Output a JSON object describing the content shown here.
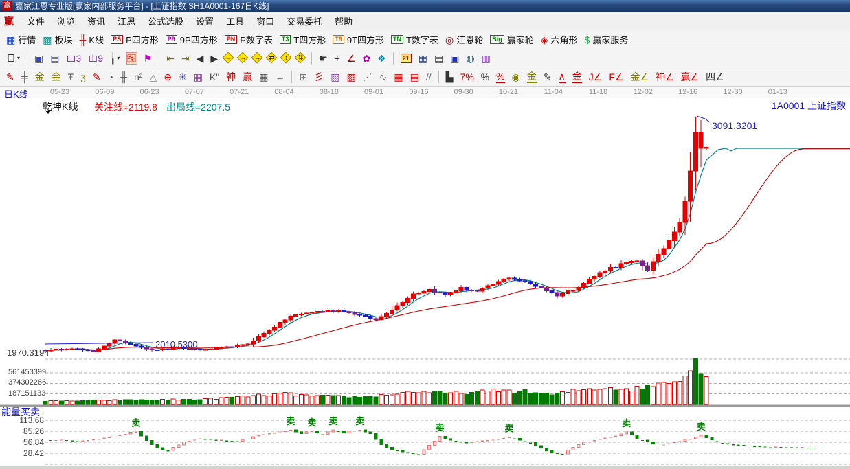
{
  "window": {
    "title": "赢家江恩专业版[赢家内部服务平台] - [上证指数  SH1A0001-167日K线]",
    "logo_char": "赢"
  },
  "menubar": {
    "items": [
      {
        "n": "menu-file",
        "label": "文件"
      },
      {
        "n": "menu-browse",
        "label": "浏览"
      },
      {
        "n": "menu-news",
        "label": "资讯"
      },
      {
        "n": "menu-gann",
        "label": "江恩"
      },
      {
        "n": "menu-formula-stock-pick",
        "label": "公式选股"
      },
      {
        "n": "menu-settings",
        "label": "设置"
      },
      {
        "n": "menu-tools",
        "label": "工具"
      },
      {
        "n": "menu-window",
        "label": "窗口"
      },
      {
        "n": "menu-trade-order",
        "label": "交易委托"
      },
      {
        "n": "menu-help",
        "label": "帮助"
      }
    ]
  },
  "toolbar_main": {
    "items": [
      {
        "n": "quotes-btn",
        "g": "▦",
        "c": "#2244bb",
        "l": "行情"
      },
      {
        "n": "sectors-btn",
        "g": "▩",
        "c": "#009090",
        "l": "板块"
      },
      {
        "n": "kline-btn",
        "g": "╫",
        "c": "#cc0000",
        "l": "K线"
      },
      {
        "n": "p-square-btn",
        "box": "PS",
        "c": "#cc0000",
        "l": "P四方形"
      },
      {
        "n": "p9-square-btn",
        "box": "P9",
        "c": "#aa00aa",
        "l": "9P四方形"
      },
      {
        "n": "p-digit-btn",
        "box": "PN",
        "c": "#cc0000",
        "l": "P数字表"
      },
      {
        "n": "t-square-btn",
        "box": "T3",
        "c": "#008800",
        "l": "T四方形"
      },
      {
        "n": "t9-square-btn",
        "box": "T9",
        "c": "#cc6600",
        "l": "9T四方形"
      },
      {
        "n": "t-digit-btn",
        "box": "TN",
        "c": "#008800",
        "l": "T数字表"
      },
      {
        "n": "gann-wheel-btn",
        "g": "◎",
        "c": "#880000",
        "l": "江恩轮"
      },
      {
        "n": "winner-wheel-btn",
        "box": "Big",
        "c": "#008800",
        "l": "赢家轮"
      },
      {
        "n": "hexagon-btn",
        "g": "◈",
        "c": "#cc0000",
        "l": "六角形"
      },
      {
        "n": "winner-service-btn",
        "g": "$",
        "c": "#22aa44",
        "l": "赢家服务"
      }
    ]
  },
  "toolbar_nav": {
    "items": [
      {
        "n": "period-day-dropdown",
        "g": "日",
        "c": "#333",
        "dd": 1
      },
      {
        "sep": 1
      },
      {
        "n": "main-view-icon",
        "g": "▣",
        "c": "#3344cc"
      },
      {
        "n": "info-list-icon",
        "g": "▤",
        "c": "#3344cc"
      },
      {
        "n": "bars3-icon",
        "g": "山3",
        "c": "#8040a0"
      },
      {
        "n": "bars9-icon",
        "g": "山9",
        "c": "#8040a0"
      },
      {
        "n": "single-candle-dropdown",
        "g": "╽",
        "c": "#333",
        "dd": 1
      },
      {
        "n": "qiankun-toggle-icon",
        "g": "图",
        "c": "#b00000",
        "hl": 1
      },
      {
        "n": "rank-flag-icon",
        "g": "⚑",
        "c": "#cc00cc"
      },
      {
        "sep": 1
      },
      {
        "n": "first-page-icon",
        "g": "⇤",
        "c": "#807000"
      },
      {
        "n": "last-page-icon",
        "g": "⇥",
        "c": "#807000"
      },
      {
        "n": "prev-page-icon",
        "g": "◀",
        "c": "#333"
      },
      {
        "n": "next-page-icon",
        "g": "▶",
        "c": "#333"
      },
      {
        "n": "compress-left-icon",
        "a": "←"
      },
      {
        "n": "expand-right-icon",
        "a": "→"
      },
      {
        "n": "expand-x-icon",
        "a": "↔"
      },
      {
        "n": "compress-x-icon",
        "a": "⇄"
      },
      {
        "n": "expand-y-icon",
        "a": "↕"
      },
      {
        "n": "compress-y-icon",
        "a": "⇅"
      },
      {
        "sep": 1
      },
      {
        "n": "hand-tool-icon",
        "g": "☛",
        "c": "#333"
      },
      {
        "n": "crosshair-icon",
        "g": "+",
        "c": "#333"
      },
      {
        "n": "measure-icon",
        "g": "∠",
        "c": "#b00000"
      },
      {
        "n": "flower-icon",
        "g": "✿",
        "c": "#aa00aa"
      },
      {
        "n": "pattern-icon",
        "g": "❖",
        "c": "#0088aa"
      },
      {
        "sep": 1
      },
      {
        "n": "calendar-icon",
        "cal": "21"
      },
      {
        "n": "calculator-icon",
        "g": "▦",
        "c": "#334477"
      },
      {
        "n": "notes-icon",
        "g": "▤",
        "c": "#334477"
      },
      {
        "n": "save-icon",
        "g": "▣",
        "c": "#2233bb"
      },
      {
        "n": "network-icon",
        "g": "◍",
        "c": "#0077aa"
      },
      {
        "n": "print-icon",
        "g": "▥",
        "c": "#7733aa"
      }
    ]
  },
  "toolbar_draw": {
    "items": [
      {
        "n": "pen-tool",
        "g": "✎",
        "c": "#b00000"
      },
      {
        "n": "grid-scale-tool",
        "g": "╪",
        "c": "#555"
      },
      {
        "n": "gold-grid-tool",
        "g": "金",
        "c": "#808000"
      },
      {
        "n": "gold-grid2-tool",
        "g": "金",
        "c": "#9a8a00"
      },
      {
        "n": "f-grid-tool",
        "g": "Ŧ",
        "c": "#555"
      },
      {
        "n": "spiral-tool",
        "g": "ʒ",
        "c": "#808000"
      },
      {
        "n": "red-pen-tool",
        "g": "✎",
        "c": "#d00000"
      },
      {
        "n": "cycle-clock-tool",
        "g": "◔",
        "c": "#555"
      },
      {
        "n": "ruler-grid-tool",
        "g": "╫",
        "c": "#555"
      },
      {
        "n": "n2-tool",
        "g": "n²",
        "c": "#555"
      },
      {
        "n": "prism-tool",
        "g": "△",
        "c": "#888"
      },
      {
        "n": "gann-circle-tool",
        "g": "⊕",
        "c": "#c00000"
      },
      {
        "n": "gann-star-tool",
        "g": "✳",
        "c": "#4040c0"
      },
      {
        "n": "web-grid-tool",
        "g": "▦",
        "c": "#8040a0"
      },
      {
        "n": "k-quote-tool",
        "g": "K\"",
        "c": "#555"
      },
      {
        "n": "shen-tool",
        "g": "神",
        "c": "#d00000"
      },
      {
        "n": "ying-tool",
        "g": "赢",
        "c": "#d00000"
      },
      {
        "n": "dense-grid-tool",
        "g": "▦",
        "c": "#555"
      },
      {
        "n": "h-extent-tool",
        "g": "↔",
        "c": "#333"
      },
      {
        "sep": 1
      },
      {
        "n": "corner-grid-tool",
        "g": "⊞",
        "c": "#777"
      },
      {
        "n": "fan-lines-tool",
        "g": "彡",
        "c": "#d00000"
      },
      {
        "n": "fan-box-tool",
        "g": "▨",
        "c": "#8040a0"
      },
      {
        "n": "fan-box2-tool",
        "g": "▧",
        "c": "#d00000"
      },
      {
        "n": "angle-fan-tool",
        "g": "⋰",
        "c": "#777"
      },
      {
        "n": "zigzag-tool",
        "g": "∿",
        "c": "#777"
      },
      {
        "n": "red-grid-tool",
        "g": "▦",
        "c": "#d00000"
      },
      {
        "n": "red-grid2-tool",
        "g": "▤",
        "c": "#d00000"
      },
      {
        "n": "diag-lines-tool",
        "g": "//",
        "c": "#777"
      },
      {
        "sep": 1
      },
      {
        "n": "bars-stat-tool",
        "g": "▙",
        "c": "#333"
      },
      {
        "n": "percent7-tool",
        "g": "7%",
        "c": "#d00000"
      },
      {
        "n": "percent-tool",
        "g": "%",
        "c": "#333"
      },
      {
        "n": "percent-line-tool",
        "g": "%",
        "c": "#d00000",
        "u": 1
      },
      {
        "n": "gold-circle-tool",
        "g": "◉",
        "c": "#808000"
      },
      {
        "n": "gold-line-tool",
        "g": "金",
        "c": "#808000",
        "u": 1
      },
      {
        "n": "candle-pen-tool",
        "g": "✎",
        "c": "#333"
      },
      {
        "n": "wave-a-tool",
        "g": "∧",
        "c": "#d00000",
        "u": 1
      },
      {
        "n": "gold-red-line-tool",
        "g": "金",
        "c": "#d00000",
        "u": 1
      },
      {
        "n": "j-angle-tool",
        "g": "J∠",
        "c": "#d00000"
      },
      {
        "n": "f-angle-tool",
        "g": "F∠",
        "c": "#d00000"
      },
      {
        "n": "gold-angle-tool",
        "g": "金∠",
        "c": "#808000"
      },
      {
        "n": "shen-angle-tool",
        "g": "神∠",
        "c": "#d00000"
      },
      {
        "n": "ying-angle-tool",
        "g": "赢∠",
        "c": "#d00000"
      },
      {
        "n": "si-angle-tool",
        "g": "四∠",
        "c": "#333"
      }
    ]
  },
  "datebar": {
    "pane_label": "日K线",
    "dates": [
      "05-23",
      "06-09",
      "06-23",
      "07-07",
      "07-21",
      "08-04",
      "08-18",
      "09-01",
      "09-16",
      "09-30",
      "10-21",
      "11-04",
      "11-18",
      "12-02",
      "12-16",
      "12-30",
      "01-13"
    ],
    "symbol_label": "1A0001  上证指数"
  },
  "chart": {
    "overlay": {
      "kline_type": "乾坤K线",
      "watch_line": "关注线=2119.8",
      "exit_line": "出局线=2207.5"
    },
    "annotations": {
      "peak_price": "3091.3201",
      "start_price": "2010.5300"
    },
    "price_axis_label": "1970.3194",
    "volume_axis": [
      "561453399",
      "374302266",
      "187151133"
    ],
    "energy": {
      "title": "能量买卖",
      "axis": [
        "113.68",
        "85.26",
        "56.84",
        "28.42"
      ],
      "sell_label": "卖"
    },
    "colors": {
      "up": "#e60000",
      "down_blue": "#1d1dcf",
      "down_purple": "#7a2090",
      "ma_fast": "#008080",
      "ma_slow": "#cc0000",
      "vol_up_stroke": "#e00000",
      "vol_down_fill": "#007a00",
      "energy_up_stroke": "#e87878",
      "energy_up_fill": "#ffd7d7",
      "energy_down": "#008a00",
      "annotation": "#2020cc",
      "sell": "#008000",
      "gridline": "#b0b0b0"
    },
    "chart_data": {
      "type": "candlestick",
      "candle_count": 125,
      "close_keypoints": [
        [
          0,
          2010
        ],
        [
          5,
          2020
        ],
        [
          9,
          2005
        ],
        [
          13,
          2058
        ],
        [
          16,
          2040
        ],
        [
          20,
          2012
        ],
        [
          25,
          2022
        ],
        [
          30,
          2014
        ],
        [
          35,
          2028
        ],
        [
          38,
          2040
        ],
        [
          42,
          2105
        ],
        [
          46,
          2168
        ],
        [
          50,
          2188
        ],
        [
          55,
          2196
        ],
        [
          58,
          2180
        ],
        [
          62,
          2152
        ],
        [
          65,
          2200
        ],
        [
          69,
          2272
        ],
        [
          72,
          2292
        ],
        [
          75,
          2268
        ],
        [
          78,
          2298
        ],
        [
          81,
          2284
        ],
        [
          84,
          2316
        ],
        [
          87,
          2348
        ],
        [
          90,
          2326
        ],
        [
          93,
          2300
        ],
        [
          96,
          2266
        ],
        [
          99,
          2292
        ],
        [
          102,
          2338
        ],
        [
          105,
          2384
        ],
        [
          108,
          2408
        ],
        [
          111,
          2422
        ],
        [
          113,
          2386
        ],
        [
          115,
          2448
        ],
        [
          117,
          2520
        ],
        [
          119,
          2610
        ],
        [
          120,
          2700
        ],
        [
          121,
          2840
        ],
        [
          122,
          3020
        ],
        [
          123,
          2945
        ],
        [
          124,
          2950
        ]
      ],
      "peak_high": 3091.3201,
      "start_close": 2010.53,
      "volume_keypoints_millions": [
        [
          0,
          55
        ],
        [
          15,
          75
        ],
        [
          30,
          90
        ],
        [
          40,
          160
        ],
        [
          45,
          190
        ],
        [
          50,
          150
        ],
        [
          55,
          140
        ],
        [
          60,
          135
        ],
        [
          65,
          180
        ],
        [
          69,
          230
        ],
        [
          75,
          200
        ],
        [
          80,
          210
        ],
        [
          85,
          250
        ],
        [
          90,
          230
        ],
        [
          95,
          170
        ],
        [
          100,
          255
        ],
        [
          105,
          300
        ],
        [
          110,
          270
        ],
        [
          113,
          320
        ],
        [
          116,
          390
        ],
        [
          118,
          440
        ],
        [
          120,
          520
        ],
        [
          121,
          600
        ],
        [
          122,
          810
        ],
        [
          123,
          640
        ],
        [
          124,
          510
        ]
      ],
      "energy_keypoints": [
        [
          0,
          62
        ],
        [
          3,
          64
        ],
        [
          6,
          60
        ],
        [
          9,
          64
        ],
        [
          13,
          72
        ],
        [
          17,
          85
        ],
        [
          19,
          60
        ],
        [
          21,
          42
        ],
        [
          23,
          36
        ],
        [
          26,
          58
        ],
        [
          29,
          66
        ],
        [
          33,
          63
        ],
        [
          36,
          60
        ],
        [
          40,
          74
        ],
        [
          43,
          82
        ],
        [
          46,
          88
        ],
        [
          48,
          80
        ],
        [
          50,
          86
        ],
        [
          52,
          78
        ],
        [
          54,
          88
        ],
        [
          56,
          82
        ],
        [
          59,
          90
        ],
        [
          61,
          78
        ],
        [
          63,
          50
        ],
        [
          65,
          38
        ],
        [
          68,
          30
        ],
        [
          70,
          27
        ],
        [
          72,
          48
        ],
        [
          74,
          72
        ],
        [
          76,
          62
        ],
        [
          79,
          56
        ],
        [
          82,
          60
        ],
        [
          85,
          66
        ],
        [
          87,
          70
        ],
        [
          89,
          62
        ],
        [
          91,
          56
        ],
        [
          93,
          42
        ],
        [
          95,
          30
        ],
        [
          97,
          27
        ],
        [
          99,
          44
        ],
        [
          101,
          56
        ],
        [
          103,
          62
        ],
        [
          106,
          70
        ],
        [
          109,
          83
        ],
        [
          111,
          66
        ],
        [
          113,
          58
        ],
        [
          115,
          48
        ],
        [
          117,
          54
        ],
        [
          119,
          60
        ],
        [
          121,
          66
        ],
        [
          123,
          75
        ],
        [
          125,
          62
        ],
        [
          127,
          56
        ],
        [
          129,
          52
        ],
        [
          132,
          48
        ],
        [
          135,
          45
        ],
        [
          138,
          44
        ],
        [
          141,
          44
        ],
        [
          144,
          43
        ]
      ],
      "sell_indices": [
        17,
        46,
        50,
        54,
        59,
        74,
        87,
        109,
        123
      ],
      "price_gridline_value": 1970.3194,
      "volume_gridline_values": [
        561453399,
        374302266,
        187151133
      ],
      "energy_gridline_values": [
        113.68,
        85.26,
        56.84,
        28.42
      ]
    }
  }
}
